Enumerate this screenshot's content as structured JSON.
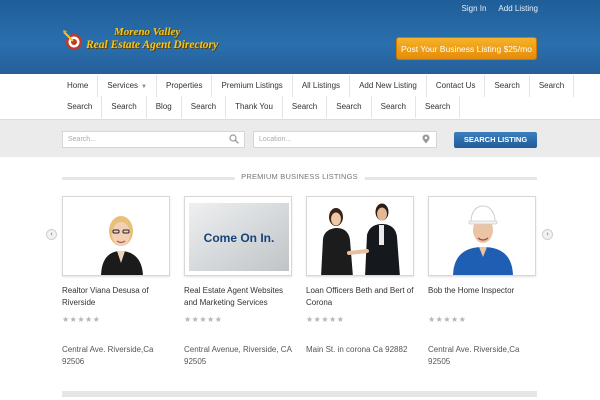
{
  "header": {
    "top_links": [
      "Sign In",
      "Add Listing"
    ],
    "logo_line1": "Moreno Valley",
    "logo_line2": "Real Estate Agent Directory",
    "post_button": "Post Your Business Listing $25/mo",
    "colors": {
      "header_blue": "#2a6fae",
      "accent_orange": "#f0a01c",
      "logo_gold": "#f5c71a"
    }
  },
  "nav": {
    "row1": [
      {
        "label": "Home"
      },
      {
        "label": "Services",
        "has_dropdown": true
      },
      {
        "label": "Properties"
      },
      {
        "label": "Premium Listings"
      },
      {
        "label": "All Listings"
      },
      {
        "label": "Add New Listing"
      },
      {
        "label": "Contact Us"
      },
      {
        "label": "Search"
      },
      {
        "label": "Search"
      }
    ],
    "row2": [
      {
        "label": "Search"
      },
      {
        "label": "Search"
      },
      {
        "label": "Blog"
      },
      {
        "label": "Search"
      },
      {
        "label": "Thank You"
      },
      {
        "label": "Search"
      },
      {
        "label": "Search"
      },
      {
        "label": "Search"
      },
      {
        "label": "Search"
      }
    ]
  },
  "search": {
    "keyword_placeholder": "Search...",
    "location_placeholder": "Location...",
    "button": "SEARCH LISTING",
    "keyword_icon": "search-icon",
    "location_icon": "map-pin-icon"
  },
  "listings": {
    "heading": "PREMIUM BUSINESS LISTINGS",
    "items": [
      {
        "title": "Realtor Viana Desusa of Riverside",
        "rating": "★★★★★",
        "address": "Central Ave. Riverside,Ca 92506",
        "image": "woman-realtor-portrait"
      },
      {
        "title": "Real Estate Agent Websites and Marketing Services",
        "rating": "★★★★★",
        "address": "Central Avenue, Riverside, CA 92505",
        "image": "come-on-in-sign",
        "image_text": "Come On In."
      },
      {
        "title": "Loan Officers Beth and Bert of Corona",
        "rating": "★★★★★",
        "address": "Main St. in corona Ca 92882",
        "image": "handshake-business-people"
      },
      {
        "title": "Bob the Home Inspector",
        "rating": "★★★★★",
        "address": "Central Ave. Riverside,Ca 92505",
        "image": "home-inspector-hardhat"
      }
    ],
    "prev_arrow": "‹",
    "next_arrow": "›"
  }
}
